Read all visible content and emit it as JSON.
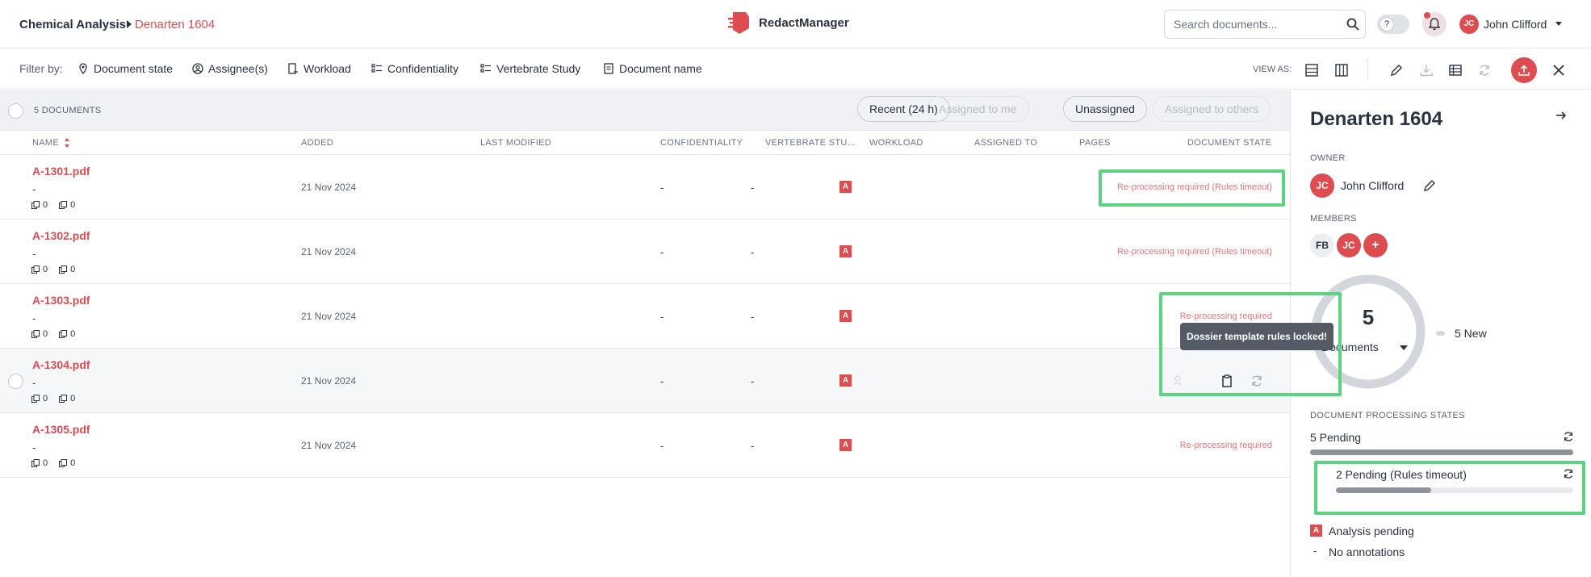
{
  "header": {
    "breadcrumb_root": "Chemical Analysis",
    "breadcrumb_current": "Denarten 1604",
    "app_name": "RedactManager",
    "search_placeholder": "Search documents...",
    "user_initials": "JC",
    "user_name": "John Clifford"
  },
  "filters": {
    "label": "Filter by:",
    "items": [
      "Document state",
      "Assignee(s)",
      "Workload",
      "Confidentiality",
      "Vertebrate Study",
      "Document name"
    ],
    "view_as": "VIEW AS:"
  },
  "list": {
    "count": "5 DOCUMENTS",
    "chips": [
      "Recent (24 h)",
      "Assigned to me",
      "Unassigned",
      "Assigned to others"
    ],
    "columns": [
      "NAME",
      "ADDED",
      "LAST MODIFIED",
      "CONFIDENTIALITY",
      "VERTEBRATE STU...",
      "WORKLOAD",
      "ASSIGNED TO",
      "PAGES",
      "DOCUMENT STATE"
    ],
    "rows": [
      {
        "name": "A-1301.pdf",
        "sub": "-",
        "c1": "0",
        "c2": "0",
        "added": "21 Nov 2024",
        "conf": "-",
        "vert": "-",
        "badge": "A",
        "state": "Re-processing required (Rules timeout)"
      },
      {
        "name": "A-1302.pdf",
        "sub": "-",
        "c1": "0",
        "c2": "0",
        "added": "21 Nov 2024",
        "conf": "-",
        "vert": "-",
        "badge": "A",
        "state": "Re-processing required (Rules timeout)"
      },
      {
        "name": "A-1303.pdf",
        "sub": "-",
        "c1": "0",
        "c2": "0",
        "added": "21 Nov 2024",
        "conf": "-",
        "vert": "-",
        "badge": "A",
        "state": "Re-processing required"
      },
      {
        "name": "A-1304.pdf",
        "sub": "-",
        "c1": "0",
        "c2": "0",
        "added": "21 Nov 2024",
        "conf": "-",
        "vert": "-",
        "badge": "A",
        "state": ""
      },
      {
        "name": "A-1305.pdf",
        "sub": "-",
        "c1": "0",
        "c2": "0",
        "added": "21 Nov 2024",
        "conf": "-",
        "vert": "-",
        "badge": "A",
        "state": "Re-processing required"
      }
    ],
    "tooltip": "Dossier template rules locked!"
  },
  "panel": {
    "title": "Denarten 1604",
    "owner_label": "OWNER",
    "owner_initials": "JC",
    "owner_name": "John Clifford",
    "members_label": "MEMBERS",
    "members": [
      "FB",
      "JC"
    ],
    "add_member": "+",
    "donut_count": "5",
    "donut_label": "Documents",
    "legend": "5 New",
    "states_label": "DOCUMENT PROCESSING STATES",
    "pending": "5 Pending",
    "pending_progress": 1.0,
    "sub_pending": "2 Pending (Rules timeout)",
    "sub_pending_progress": 0.4,
    "analysis_badge": "A",
    "analysis": "Analysis pending",
    "no_annot_dash": "-",
    "no_annot": "No annotations"
  },
  "colors": {
    "accent": "#dd4d50",
    "highlight": "#5bd482"
  }
}
